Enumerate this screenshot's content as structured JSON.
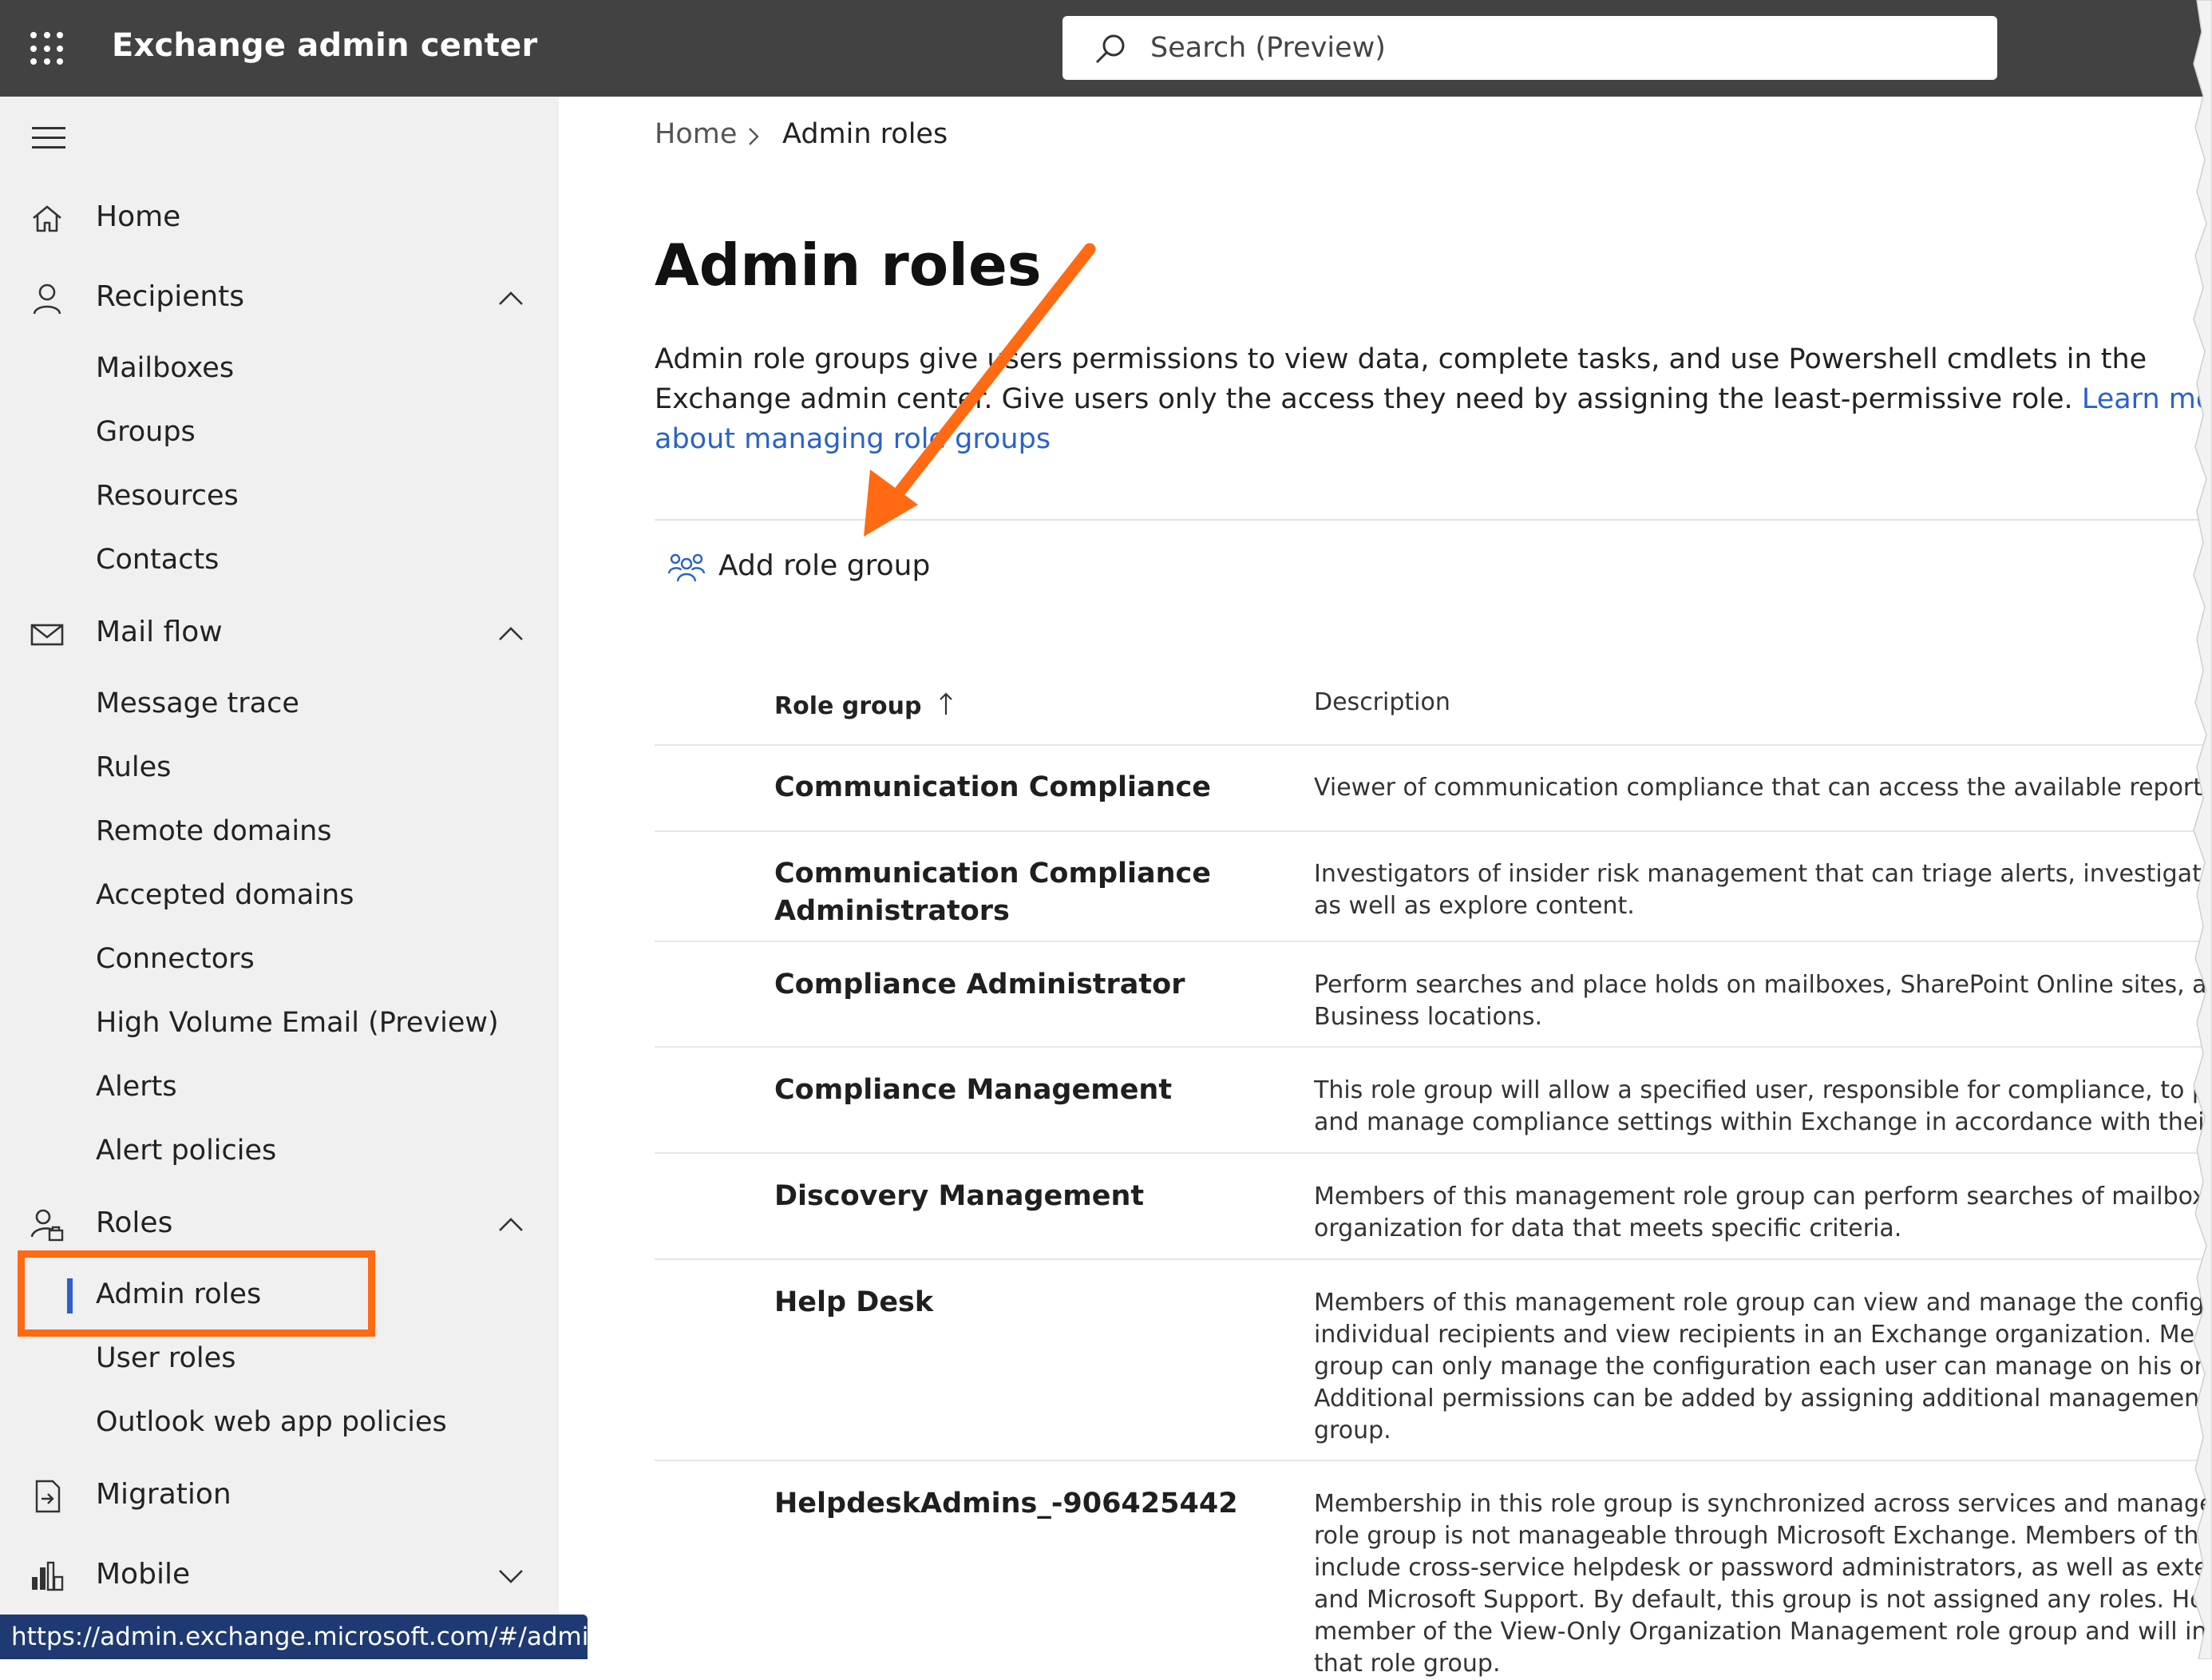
{
  "header": {
    "app_title": "Exchange admin center",
    "search_placeholder": "Search (Preview)"
  },
  "sidebar": {
    "home": "Home",
    "recipients": {
      "label": "Recipients",
      "items": [
        "Mailboxes",
        "Groups",
        "Resources",
        "Contacts"
      ]
    },
    "mail_flow": {
      "label": "Mail flow",
      "items": [
        "Message trace",
        "Rules",
        "Remote domains",
        "Accepted domains",
        "Connectors",
        "High Volume Email (Preview)",
        "Alerts",
        "Alert policies"
      ]
    },
    "roles": {
      "label": "Roles",
      "items": [
        "Admin roles",
        "User roles",
        "Outlook web app policies"
      ]
    },
    "migration": "Migration",
    "mobile": "Mobile"
  },
  "status_url": "https://admin.exchange.microsoft.com/#/adminRoles",
  "breadcrumb": {
    "home": "Home",
    "current": "Admin roles"
  },
  "page": {
    "title": "Admin roles",
    "description_1": "Admin role groups give users permissions to view data, complete tasks, and use Powershell cmdlets in the",
    "description_2": "Exchange admin center. Give users only the access they need by assigning the least-permissive role. ",
    "link_1": "Learn more",
    "link_2": "about managing role groups"
  },
  "toolbar": {
    "add_role_group": "Add role group"
  },
  "table": {
    "columns": [
      "Role group",
      "Description"
    ],
    "rows": [
      {
        "name": [
          "Communication Compliance"
        ],
        "desc": [
          "Viewer of communication compliance that can access the available reports and widgets."
        ]
      },
      {
        "name": [
          "Communication Compliance",
          "Administrators"
        ],
        "desc": [
          "Investigators of insider risk management that can triage alerts, investigate and action cases,",
          "as well as explore content."
        ]
      },
      {
        "name": [
          "Compliance Administrator"
        ],
        "desc": [
          "Perform searches and place holds on mailboxes, SharePoint Online sites, and OneDrive for",
          "Business locations."
        ]
      },
      {
        "name": [
          "Compliance Management"
        ],
        "desc": [
          "This role group will allow a specified user, responsible for compliance, to properly configure",
          "and manage compliance settings within Exchange in accordance with their policy."
        ]
      },
      {
        "name": [
          "Discovery Management"
        ],
        "desc": [
          "Members of this management role group can perform searches of mailboxes in the Exchange",
          "organization for data that meets specific criteria."
        ]
      },
      {
        "name": [
          "Help Desk"
        ],
        "desc": [
          "Members of this management role group can view and manage the configuration for",
          "individual recipients and view recipients in an Exchange organization. Members of this role",
          "group can only manage the configuration each user can manage on his or her own mailbox.",
          "Additional permissions can be added by assigning additional management roles to this role",
          "group."
        ]
      },
      {
        "name": [
          "HelpdeskAdmins_-906425442"
        ],
        "desc": [
          "Membership in this role group is synchronized across services and managed centrally. This",
          "role group is not manageable through Microsoft Exchange. Members of this role group may",
          "include cross-service helpdesk or password administrators, as well as external partner groups",
          "and Microsoft Support. By default, this group is not assigned any roles. However, it will be a",
          "member of the View-Only Organization Management role group and will inherit the rights of",
          "that role group."
        ]
      }
    ]
  },
  "colors": {
    "accent_orange": "#ff6a13",
    "topbar": "#424242",
    "sidebar_bg": "#f0f0f0",
    "link": "#2a62c9",
    "active_indicator": "#2f5dd0"
  }
}
